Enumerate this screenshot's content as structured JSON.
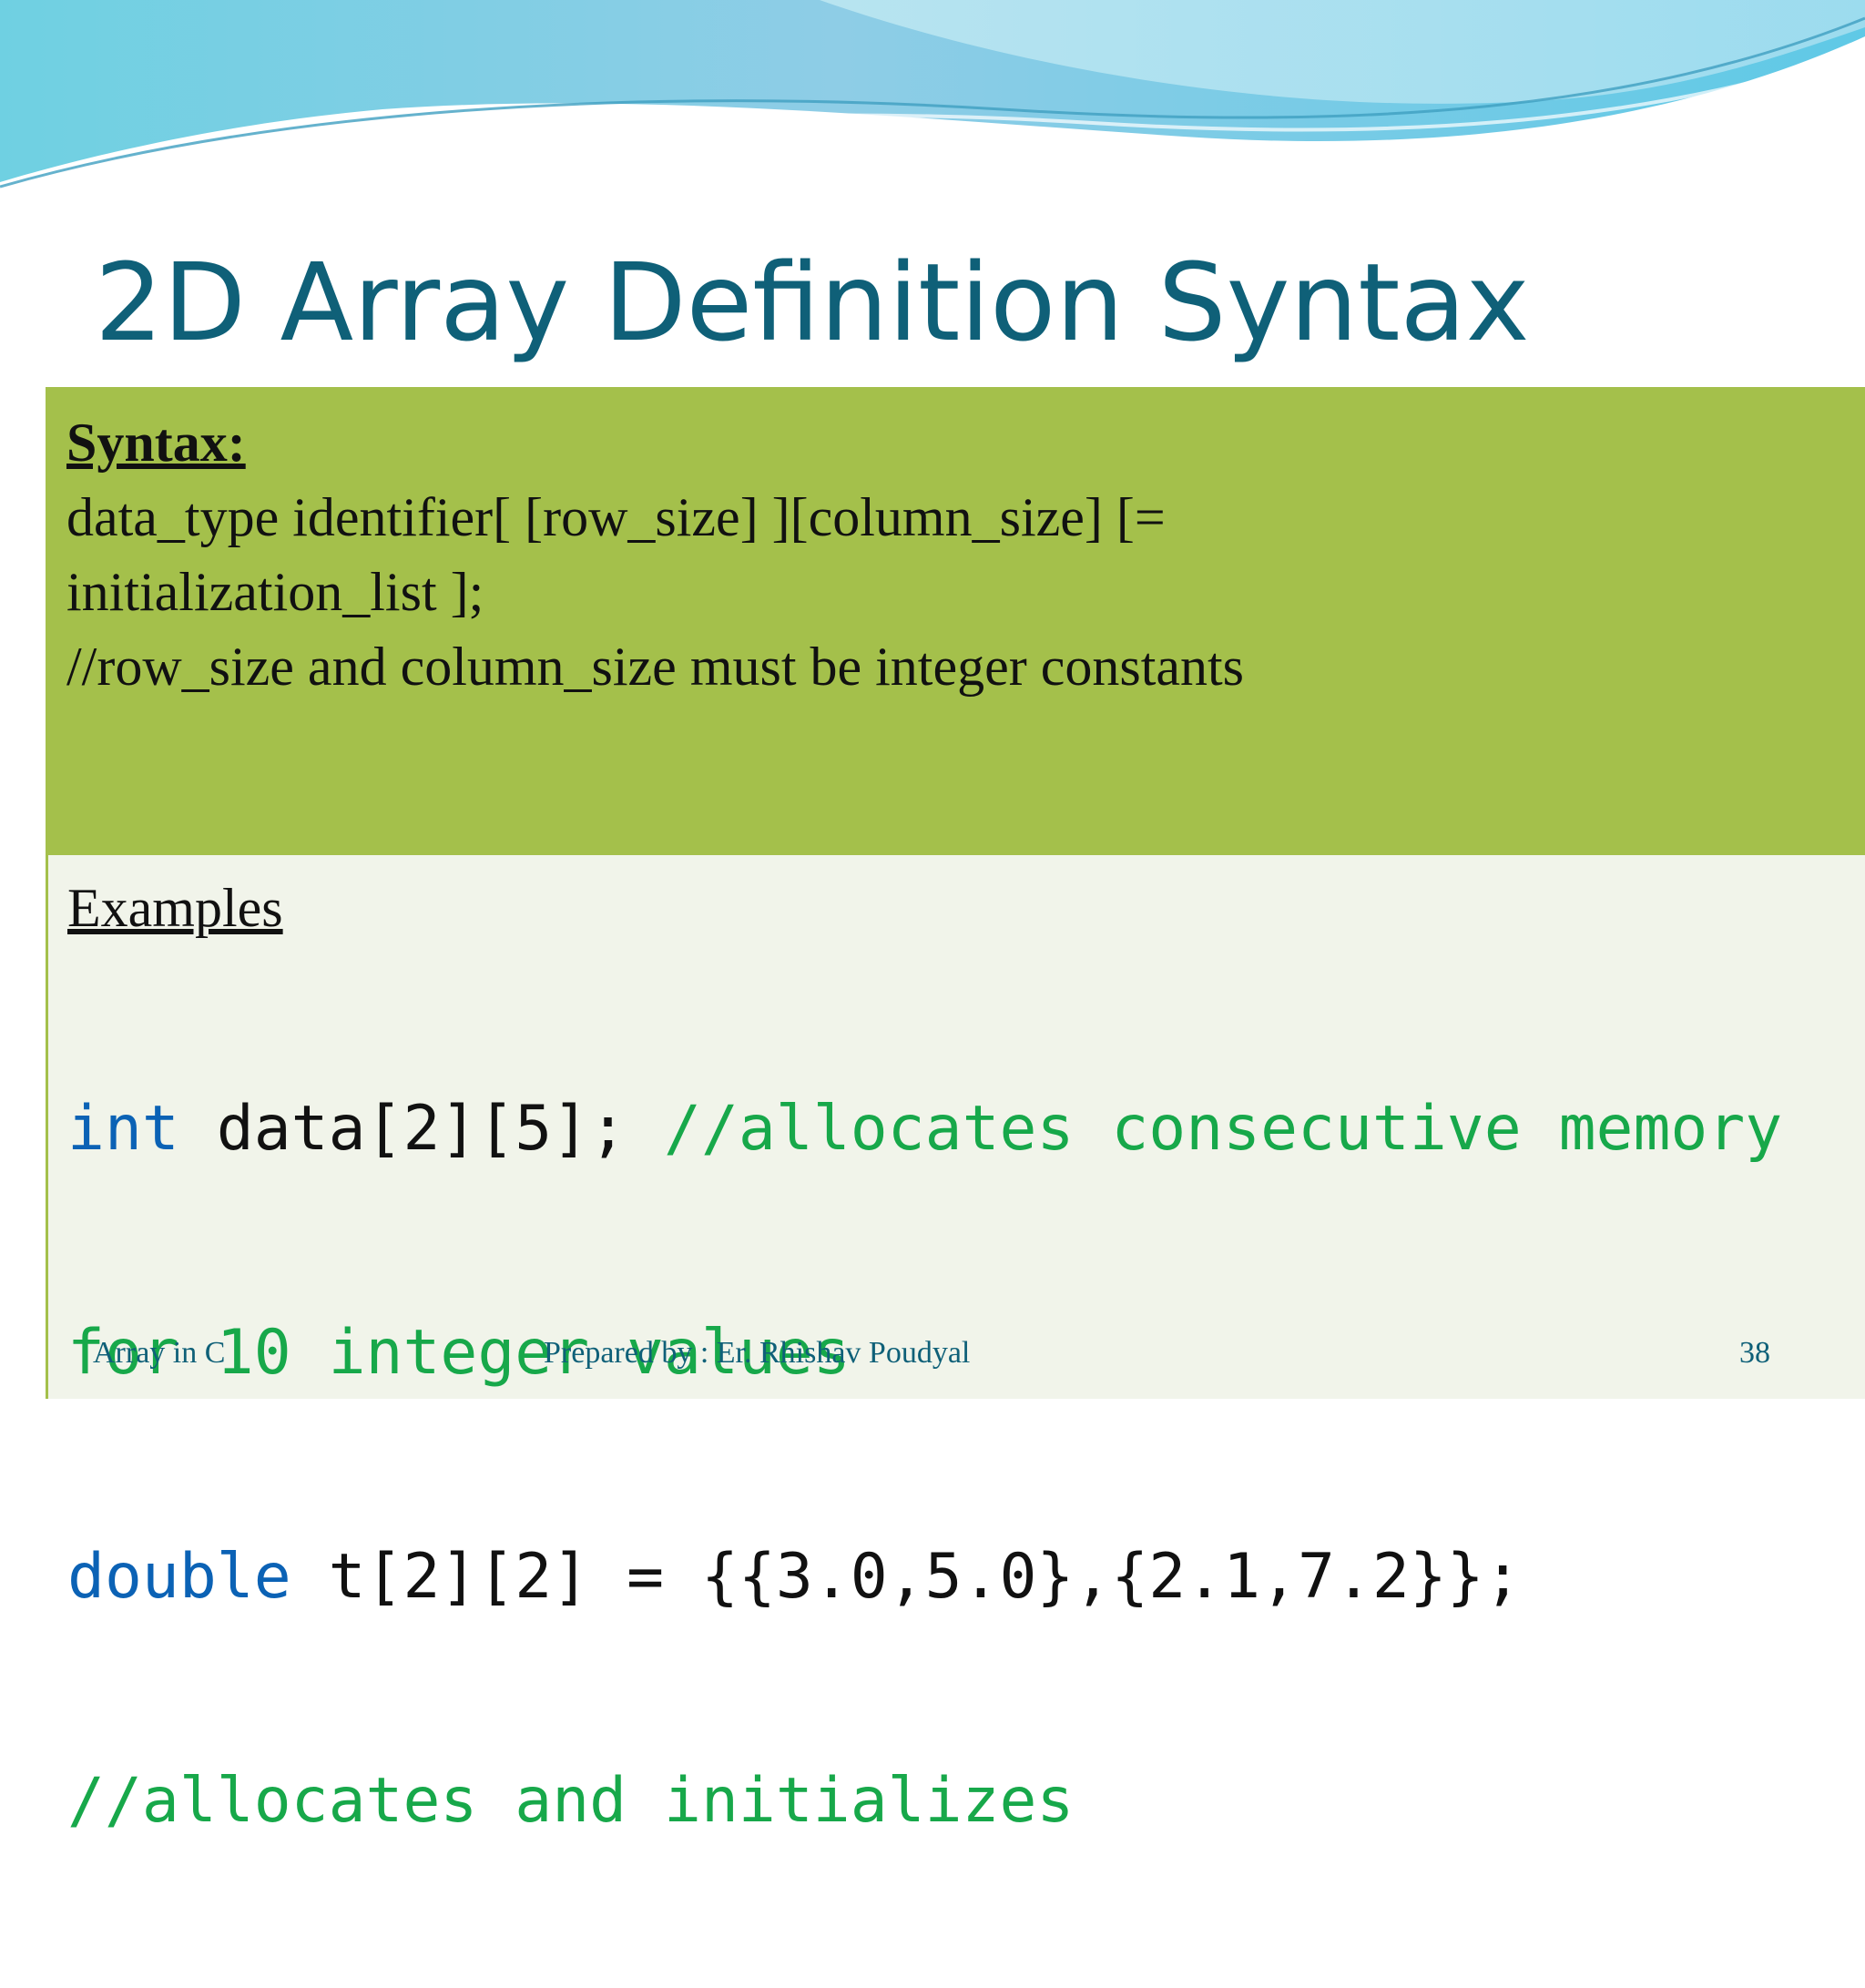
{
  "slide": {
    "title": "2D Array Definition Syntax",
    "syntax": {
      "heading": "Syntax:",
      "lines": [
        "data_type identifier[ [row_size] ][column_size]  [=",
        "initialization_list ];",
        "//row_size and column_size must be integer constants"
      ]
    },
    "examples": {
      "heading": "Examples",
      "code": [
        {
          "keyword": "int",
          "statement": " data[2][5]; ",
          "comment": "//allocates consecutive memory"
        },
        {
          "comment": "for 10 integer values"
        },
        {
          "keyword": "double",
          "statement": " t[2][2] = {{3.0,5.0},{2.1,7.2}};"
        },
        {
          "comment": "//allocates and initializes"
        }
      ]
    },
    "footer": {
      "left": "Array in C",
      "center": "Prepared by : Er. Rhishav Poudyal",
      "page_number": "38"
    }
  },
  "colors": {
    "title": "#0f6078",
    "syntax_background": "#a4c04b",
    "examples_background": "#f1f4ea",
    "code_keyword": "#0b62b5",
    "code_comment": "#17a84a",
    "code_text": "#111111"
  }
}
